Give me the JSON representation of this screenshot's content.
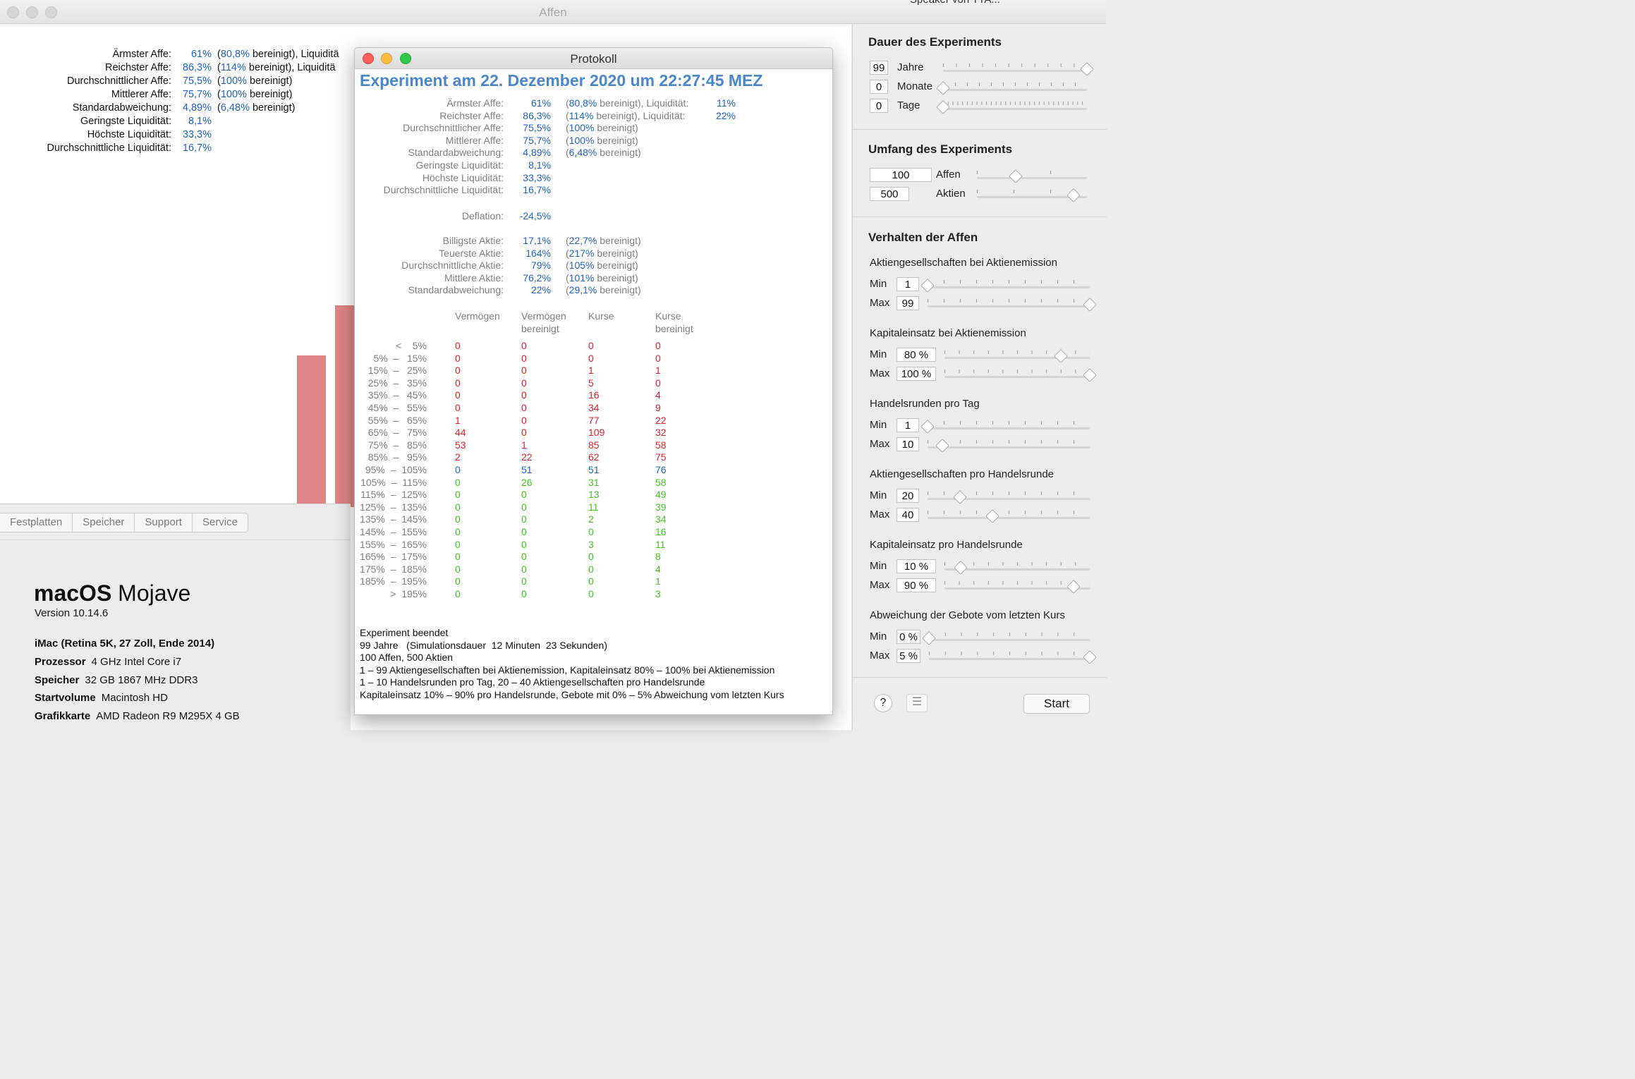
{
  "main_window": {
    "title": "Affen",
    "peek_text": "Speaker von TTA..."
  },
  "bg_stats": [
    {
      "label": "Ärmster Affe:",
      "value": "61%",
      "extra_open": "(",
      "extra_num": "80,8%",
      "extra_text": " bereinigt), Liquiditä"
    },
    {
      "label": "Reichster Affe:",
      "value": "86,3%",
      "extra_open": "(",
      "extra_num": "114%",
      "extra_text": " bereinigt), Liquiditä"
    },
    {
      "label": "Durchschnittlicher Affe:",
      "value": "75,5%",
      "extra_open": "(",
      "extra_num": "100%",
      "extra_text": " bereinigt)"
    },
    {
      "label": "Mittlerer Affe:",
      "value": "75,7%",
      "extra_open": "(",
      "extra_num": "100%",
      "extra_text": " bereinigt)"
    },
    {
      "label": "Standardabweichung:",
      "value": "4,89%",
      "extra_open": "(",
      "extra_num": "6,48%",
      "extra_text": " bereinigt)"
    },
    {
      "label": "Geringste Liquidität:",
      "value": "8,1%"
    },
    {
      "label": "Höchste Liquidität:",
      "value": "33,3%"
    },
    {
      "label": "Durchschnittliche Liquidität:",
      "value": "16,7%"
    }
  ],
  "about_mac": {
    "tabs": [
      "Festplatten",
      "Speicher",
      "Support",
      "Service"
    ],
    "os_name_bold": "macOS",
    "os_name_light": "Mojave",
    "version": "Version 10.14.6",
    "model": "iMac (Retina 5K, 27 Zoll, Ende 2014)",
    "specs": [
      {
        "label": "Prozessor",
        "value": "4 GHz Intel Core i7"
      },
      {
        "label": "Speicher",
        "value": "32 GB 1867 MHz DDR3"
      },
      {
        "label": "Startvolume",
        "value": "Macintosh HD"
      },
      {
        "label": "Grafikkarte",
        "value": "AMD Radeon R9 M295X 4 GB"
      }
    ]
  },
  "sidebar": {
    "dauer": {
      "title": "Dauer des Experiments",
      "rows": [
        {
          "value": "99",
          "label": "Jahre",
          "level": 1.0
        },
        {
          "value": "0",
          "label": "Monate",
          "level": 0.0
        },
        {
          "value": "0",
          "label": "Tage",
          "level": 0.0
        }
      ]
    },
    "umfang": {
      "title": "Umfang des Experiments",
      "rows": [
        {
          "value": "100",
          "label": "Affen",
          "level": 0.35
        },
        {
          "value": "500",
          "label": "Aktien",
          "level": 0.88
        }
      ]
    },
    "verhalten": {
      "title": "Verhalten der Affen",
      "groups": [
        {
          "title": "Aktiengesellschaften bei Aktienemission",
          "min": "1",
          "max": "99",
          "min_level": 0.0,
          "max_level": 1.0
        },
        {
          "title": "Kapitaleinsatz bei Aktienemission",
          "min": "80 %",
          "max": "100 %",
          "min_level": 0.8,
          "max_level": 1.0
        },
        {
          "title": "Handelsrunden pro Tag",
          "min": "1",
          "max": "10",
          "min_level": 0.0,
          "max_level": 0.09
        },
        {
          "title": "Aktiengesellschaften pro Handelsrunde",
          "min": "20",
          "max": "40",
          "min_level": 0.2,
          "max_level": 0.4
        },
        {
          "title": "Kapitaleinsatz pro Handelsrunde",
          "min": "10 %",
          "max": "90 %",
          "min_level": 0.11,
          "max_level": 0.89
        },
        {
          "title": "Abweichung der Gebote vom letzten Kurs",
          "min": "0 %",
          "max": "5 %",
          "min_level": 0.0,
          "max_level": 1.0
        }
      ],
      "min_label": "Min",
      "max_label": "Max"
    },
    "help_label": "?",
    "list_label": "☰",
    "start_label": "Start"
  },
  "protokoll": {
    "title": "Protokoll",
    "heading": "Experiment am 22. Dezember 2020 um 22:27:45 MEZ",
    "affen_stats": [
      {
        "label": "Ärmster Affe:",
        "value": "61%",
        "open": "(",
        "num": "80,8%",
        "text": " bereinigt), Liquidität:",
        "liq": "11%"
      },
      {
        "label": "Reichster Affe:",
        "value": "86,3%",
        "open": "(",
        "num": "114%",
        "text": " bereinigt), Liquidität:",
        "liq": "22%"
      },
      {
        "label": "Durchschnittlicher Affe:",
        "value": "75,5%",
        "open": "(",
        "num": "100%",
        "text": " bereinigt)"
      },
      {
        "label": "Mittlerer Affe:",
        "value": "75,7%",
        "open": "(",
        "num": "100%",
        "text": " bereinigt)"
      },
      {
        "label": "Standardabweichung:",
        "value": "4,89%",
        "open": "(",
        "num": "6,48%",
        "text": " bereinigt)"
      },
      {
        "label": "Geringste Liquidität:",
        "value": "8,1%"
      },
      {
        "label": "Höchste Liquidität:",
        "value": "33,3%"
      },
      {
        "label": "Durchschnittliche Liquidität:",
        "value": "16,7%"
      }
    ],
    "deflation": {
      "label": "Deflation:",
      "value": "-24,5%"
    },
    "aktien_stats": [
      {
        "label": "Billigste Aktie:",
        "value": "17,1%",
        "open": "(",
        "num": "22,7%",
        "text": " bereinigt)"
      },
      {
        "label": "Teuerste Aktie:",
        "value": "164%",
        "open": "(",
        "num": "217%",
        "text": " bereinigt)"
      },
      {
        "label": "Durchschnittliche Aktie:",
        "value": "79%",
        "open": "(",
        "num": "105%",
        "text": " bereinigt)"
      },
      {
        "label": "Mittlere Aktie:",
        "value": "76,2%",
        "open": "(",
        "num": "101%",
        "text": " bereinigt)"
      },
      {
        "label": "Standardabweichung:",
        "value": "22%",
        "open": "(",
        "num": "29,1%",
        "text": " bereinigt)"
      }
    ],
    "table_headers": [
      {
        "line1": "Vermögen",
        "line2": ""
      },
      {
        "line1": "Vermögen",
        "line2": "bereinigt"
      },
      {
        "line1": "Kurse",
        "line2": ""
      },
      {
        "line1": "Kurse",
        "line2": "bereinigt"
      }
    ],
    "table_rows": [
      {
        "range": "<    5%",
        "c": [
          "0",
          "0",
          "0",
          "0"
        ],
        "color": "red"
      },
      {
        "range": "5%  –   15%",
        "c": [
          "0",
          "0",
          "0",
          "0"
        ],
        "color": "red"
      },
      {
        "range": "15%  –   25%",
        "c": [
          "0",
          "0",
          "1",
          "1"
        ],
        "color": "red"
      },
      {
        "range": "25%  –   35%",
        "c": [
          "0",
          "0",
          "5",
          "0"
        ],
        "color": "red"
      },
      {
        "range": "35%  –   45%",
        "c": [
          "0",
          "0",
          "16",
          "4"
        ],
        "color": "red"
      },
      {
        "range": "45%  –   55%",
        "c": [
          "0",
          "0",
          "34",
          "9"
        ],
        "color": "red"
      },
      {
        "range": "55%  –   65%",
        "c": [
          "1",
          "0",
          "77",
          "22"
        ],
        "color": "red"
      },
      {
        "range": "65%  –   75%",
        "c": [
          "44",
          "0",
          "109",
          "32"
        ],
        "color": "red"
      },
      {
        "range": "75%  –   85%",
        "c": [
          "53",
          "1",
          "85",
          "58"
        ],
        "color": "red"
      },
      {
        "range": "85%  –   95%",
        "c": [
          "2",
          "22",
          "62",
          "75"
        ],
        "color": "red"
      },
      {
        "range": "95%  –  105%",
        "c": [
          "0",
          "51",
          "51",
          "76"
        ],
        "color": "blue"
      },
      {
        "range": "105%  –  115%",
        "c": [
          "0",
          "26",
          "31",
          "58"
        ],
        "color": "green"
      },
      {
        "range": "115%  –  125%",
        "c": [
          "0",
          "0",
          "13",
          "49"
        ],
        "color": "green"
      },
      {
        "range": "125%  –  135%",
        "c": [
          "0",
          "0",
          "11",
          "39"
        ],
        "color": "green"
      },
      {
        "range": "135%  –  145%",
        "c": [
          "0",
          "0",
          "2",
          "34"
        ],
        "color": "green"
      },
      {
        "range": "145%  –  155%",
        "c": [
          "0",
          "0",
          "0",
          "16"
        ],
        "color": "green"
      },
      {
        "range": "155%  –  165%",
        "c": [
          "0",
          "0",
          "3",
          "11"
        ],
        "color": "green"
      },
      {
        "range": "165%  –  175%",
        "c": [
          "0",
          "0",
          "0",
          "8"
        ],
        "color": "green"
      },
      {
        "range": "175%  –  185%",
        "c": [
          "0",
          "0",
          "0",
          "4"
        ],
        "color": "green"
      },
      {
        "range": "185%  –  195%",
        "c": [
          "0",
          "0",
          "0",
          "1"
        ],
        "color": "green"
      },
      {
        "range": ">  195%",
        "c": [
          "0",
          "0",
          "0",
          "3"
        ],
        "color": "green"
      }
    ],
    "summary": [
      "Experiment beendet",
      "99 Jahre   (Simulationsdauer  12 Minuten  23 Sekunden)",
      "100 Affen, 500 Aktien",
      "1 – 99 Aktiengesellschaften bei Aktienemission, Kapitaleinsatz 80% – 100% bei Aktienemission",
      "1 – 10 Handelsrunden pro Tag, 20 – 40 Aktiengesellschaften pro Handelsrunde",
      "Kapitaleinsatz 10% – 90% pro Handelsrunde, Gebote mit 0% – 5% Abweichung vom letzten Kurs"
    ]
  }
}
